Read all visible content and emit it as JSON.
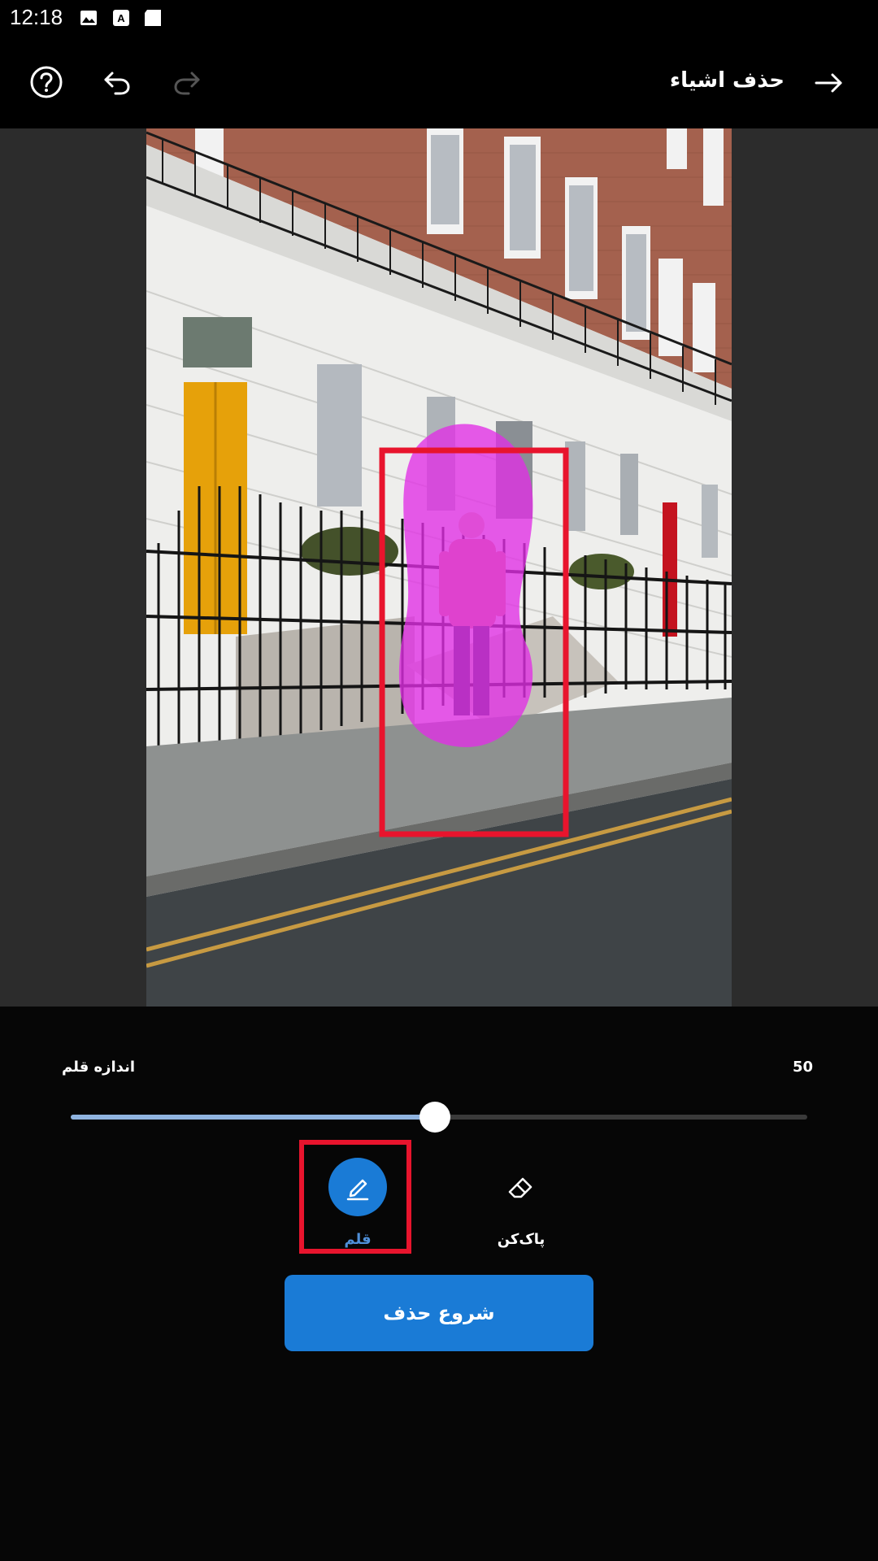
{
  "status_bar": {
    "time": "12:18",
    "icons": [
      "image-icon",
      "translate-icon",
      "sd-card-icon"
    ]
  },
  "header": {
    "title": "حذف اشیاء",
    "icons": [
      "help-icon",
      "undo-icon",
      "redo-icon",
      "forward-arrow-icon"
    ]
  },
  "editor": {
    "photo_description_icon": "street-photo"
  },
  "brush_size": {
    "label": "اندازه قلم",
    "value": "50",
    "fraction": 0.495
  },
  "tools": {
    "brush_label": "قلم",
    "eraser_label": "پاک‌کن"
  },
  "actions": {
    "start_label": "شروع حذف"
  },
  "colors": {
    "accent": "#1a7bd6",
    "mask": "#e22ee6",
    "highlight": "#e8142d"
  }
}
